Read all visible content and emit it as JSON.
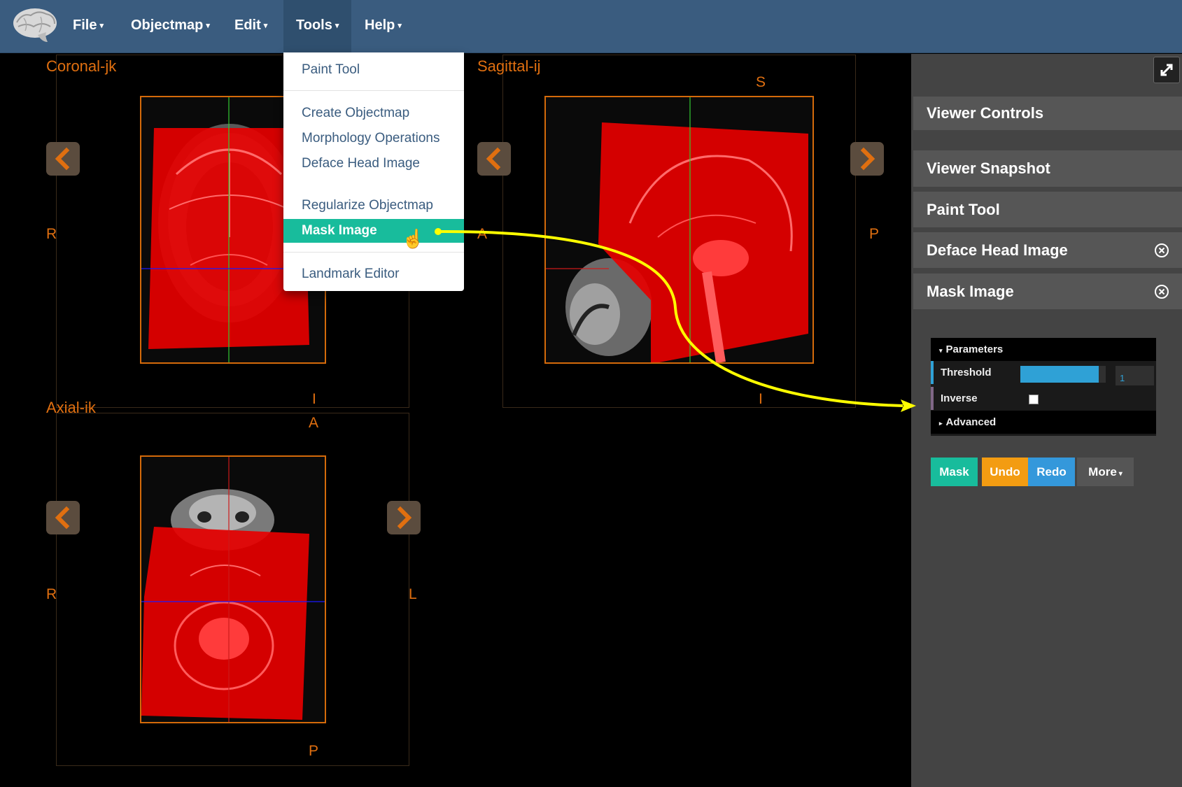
{
  "navbar": {
    "menus": [
      {
        "label": "File"
      },
      {
        "label": "Objectmap"
      },
      {
        "label": "Edit"
      },
      {
        "label": "Tools"
      },
      {
        "label": "Help"
      }
    ]
  },
  "tools_menu": {
    "items": [
      {
        "label": "Paint Tool"
      },
      {
        "label": "Create Objectmap"
      },
      {
        "label": "Morphology Operations"
      },
      {
        "label": "Deface Head Image"
      },
      {
        "label": "Regularize Objectmap"
      },
      {
        "label": "Mask Image",
        "highlighted": true
      },
      {
        "label": "Landmark Editor"
      }
    ]
  },
  "viewer": {
    "coronal": {
      "label": "Coronal-jk",
      "left": "R",
      "bottom": "I"
    },
    "sagittal": {
      "label": "Sagittal-ij",
      "top": "S",
      "left": "A",
      "right": "P",
      "bottom": "I"
    },
    "axial": {
      "label": "Axial-ik",
      "top": "A",
      "left": "R",
      "right": "L",
      "bottom": "P"
    }
  },
  "sidebar": {
    "panels": [
      {
        "label": "Viewer Controls",
        "closable": false
      },
      {
        "label": "Viewer Snapshot",
        "closable": false
      },
      {
        "label": "Paint Tool",
        "closable": false
      },
      {
        "label": "Deface Head Image",
        "closable": true
      },
      {
        "label": "Mask Image",
        "closable": true
      }
    ],
    "mask_gui": {
      "parameters_label": "Parameters",
      "threshold_label": "Threshold",
      "threshold_value": "1",
      "threshold_fill_fraction": 0.92,
      "inverse_label": "Inverse",
      "inverse_checked": false,
      "advanced_label": "Advanced"
    },
    "buttons": [
      {
        "label": "Mask",
        "color": "#18bc9c"
      },
      {
        "label": "Undo",
        "color": "#f39c12"
      },
      {
        "label": "Redo",
        "color": "#3498db"
      },
      {
        "label": "More",
        "color": "#555555"
      }
    ]
  },
  "colors": {
    "navbar": "#3a5c7f",
    "mask_overlay": "#e60000",
    "orientation_text": "#e06f10",
    "annotation_arrow": "#ffff00"
  },
  "icons": {
    "brain_logo": "brain-logo-icon",
    "collapse": "collapse-arrows-icon",
    "close": "close-circle-icon",
    "prev": "chevron-left-icon",
    "next": "chevron-right-icon",
    "cursor": "hand-pointer-icon"
  }
}
